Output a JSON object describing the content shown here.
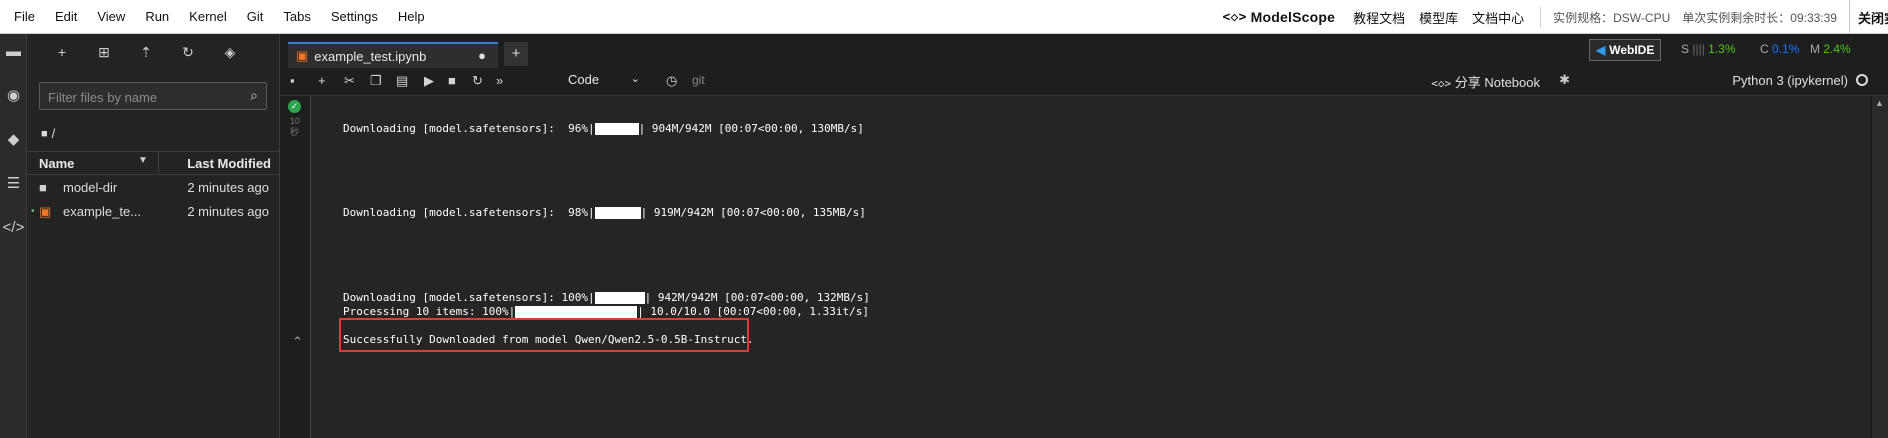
{
  "menubar": {
    "items": [
      "File",
      "Edit",
      "View",
      "Run",
      "Kernel",
      "Git",
      "Tabs",
      "Settings",
      "Help"
    ],
    "logo": "ModelScope",
    "links": [
      "教程文档",
      "模型库",
      "文档中心"
    ],
    "instance_spec": "实例规格：DSW-CPU",
    "remaining_time": "单次实例剩余时长：09:33:39",
    "close_label": "关闭实例"
  },
  "sidebar": {
    "icons": [
      "folder-icon",
      "stop-circle-icon",
      "git-icon",
      "list-icon",
      "code-icon"
    ]
  },
  "file_browser": {
    "filter_placeholder": "Filter files by name",
    "path": "/",
    "columns": {
      "name": "Name",
      "modified": "Last Modified"
    },
    "files": [
      {
        "name": "model-dir",
        "modified": "2 minutes ago",
        "type": "folder"
      },
      {
        "name": "example_te...",
        "modified": "2 minutes ago",
        "type": "notebook"
      }
    ]
  },
  "tabs": [
    {
      "label": "example_test.ipynb",
      "dirty": "●"
    }
  ],
  "webide": {
    "label": "WebIDE",
    "s_value": "1.3%",
    "c_value": "0.1%",
    "m_value": "2.4%"
  },
  "notebook_toolbar": {
    "cell_type": "Code",
    "git": "git",
    "share": "分享 Notebook",
    "kernel": "Python 3 (ipykernel)"
  },
  "cell": {
    "exec_time": "10\n秒",
    "outputs": [
      {
        "text_a": "Downloading [model.safetensors]:  96%|",
        "text_b": "| 904M/942M [00:07<00:00, 130MB/s]",
        "progress": 0.96
      },
      {
        "text_a": "Downloading [model.safetensors]:  98%|",
        "text_b": "| 919M/942M [00:07<00:00, 135MB/s]",
        "progress": 0.98
      },
      {
        "text_a": "Downloading [model.safetensors]: 100%|",
        "text_b": "| 942M/942M [00:07<00:00, 132MB/s]",
        "progress": 1.0
      },
      {
        "text_a": "Processing 10 items: 100%|",
        "text_b": "| 10.0/10.0 [00:07<00:00, 1.33it/s]",
        "progress": 1.0
      }
    ],
    "success_message": "Successfully Downloaded from model Qwen/Qwen2.5-0.5B-Instruct."
  },
  "colors": {
    "accent": "#2f7ed8",
    "highlight": "#e53935",
    "ok": "#2da44e"
  }
}
